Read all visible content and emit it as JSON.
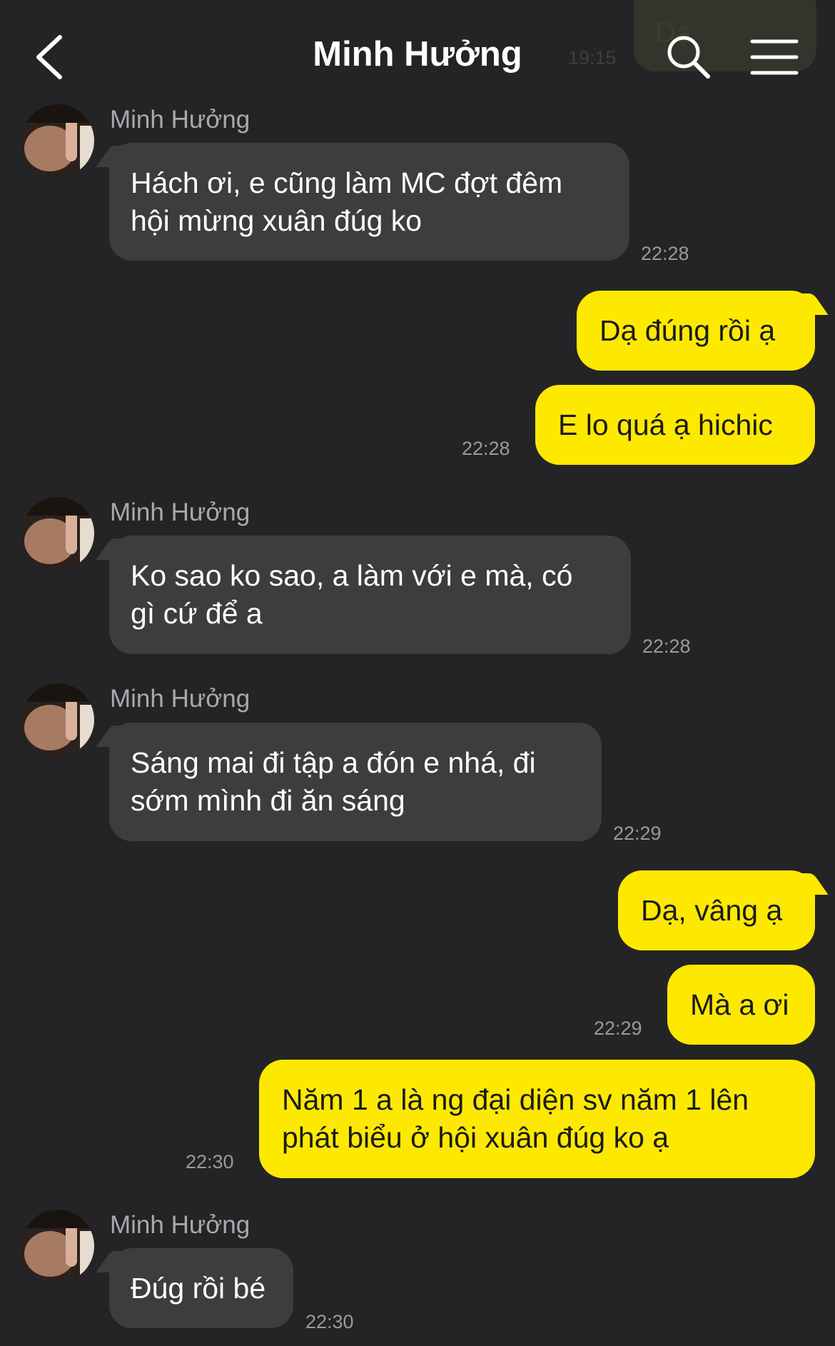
{
  "header": {
    "title": "Minh Hưởng",
    "back_icon": "chevron-left-icon",
    "search_icon": "search-icon",
    "menu_icon": "hamburger-menu-icon"
  },
  "background_peek": {
    "text": "Dạ",
    "time": "19:15"
  },
  "messages": [
    {
      "direction": "in",
      "sender": "Minh Hưởng",
      "lines": [
        "Hách ơi, e cũng làm MC đợt đêm",
        "hội mừng xuân đúg ko"
      ],
      "time": "22:28"
    },
    {
      "direction": "out",
      "lines": [
        "Dạ đúng rồi ạ"
      ]
    },
    {
      "direction": "out",
      "lines": [
        "E lo quá ạ hichic"
      ],
      "time": "22:28"
    },
    {
      "direction": "in",
      "sender": "Minh Hưởng",
      "lines": [
        "Ko sao ko sao, a làm với e mà, có",
        "gì cứ để a"
      ],
      "time": "22:28"
    },
    {
      "direction": "in",
      "sender": "Minh Hưởng",
      "lines": [
        "Sáng mai đi tập a đón e nhá, đi",
        "sớm mình đi ăn sáng"
      ],
      "time": "22:29"
    },
    {
      "direction": "out",
      "lines": [
        "Dạ, vâng ạ"
      ]
    },
    {
      "direction": "out",
      "lines": [
        "Mà a ơi"
      ],
      "time": "22:29"
    },
    {
      "direction": "out",
      "lines": [
        "Năm 1 a là ng đại diện sv năm 1 lên",
        "phát biểu ở hội xuân đúg ko ạ"
      ],
      "time": "22:30"
    },
    {
      "direction": "in",
      "sender": "Minh Hưởng",
      "lines": [
        "Đúg rồi bé"
      ],
      "time": "22:30"
    }
  ],
  "colors": {
    "background": "#242426",
    "incoming_bubble": "#3d3d40",
    "outgoing_bubble": "#fde900",
    "timestamp": "#9a9a9e"
  }
}
